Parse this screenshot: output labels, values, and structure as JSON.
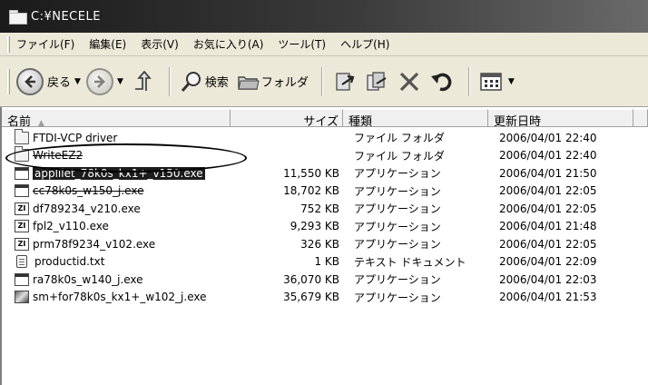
{
  "window": {
    "title": "C:¥NECELE"
  },
  "menu": [
    "ファイル(F)",
    "編集(E)",
    "表示(V)",
    "お気に入り(A)",
    "ツール(T)",
    "ヘルプ(H)"
  ],
  "toolbar": {
    "back_label": "戻る",
    "search_label": "検索",
    "folders_label": "フォルダ"
  },
  "columns": {
    "name": "名前",
    "size": "サイズ",
    "type": "種類",
    "modified": "更新日時"
  },
  "files": [
    {
      "icon": "folder-icon",
      "name": "FTDI-VCP driver",
      "size": "",
      "type": "ファイル フォルダ",
      "modified": "2006/04/01 22:40"
    },
    {
      "icon": "folder-icon",
      "name": "WriteEZ2",
      "size": "",
      "type": "ファイル フォルダ",
      "modified": "2006/04/01 22:40"
    },
    {
      "icon": "application-icon",
      "name": "applilet_78k0s_kx1+_v150.exe",
      "size": "11,550 KB",
      "type": "アプリケーション",
      "modified": "2006/04/01 21:50"
    },
    {
      "icon": "application-icon",
      "name": "cc78k0s_w150_j.exe",
      "size": "18,702 KB",
      "type": "アプリケーション",
      "modified": "2006/04/01 22:05"
    },
    {
      "icon": "archive-icon",
      "name": "df789234_v210.exe",
      "size": "752 KB",
      "type": "アプリケーション",
      "modified": "2006/04/01 22:05"
    },
    {
      "icon": "archive-icon",
      "name": "fpl2_v110.exe",
      "size": "9,293 KB",
      "type": "アプリケーション",
      "modified": "2006/04/01 21:48"
    },
    {
      "icon": "archive-icon",
      "name": "prm78f9234_v102.exe",
      "size": "326 KB",
      "type": "アプリケーション",
      "modified": "2006/04/01 22:05"
    },
    {
      "icon": "text-document-icon",
      "name": "productid.txt",
      "size": "1 KB",
      "type": "テキスト ドキュメント",
      "modified": "2006/04/01 22:09"
    },
    {
      "icon": "application-icon",
      "name": "ra78k0s_w140_j.exe",
      "size": "36,070 KB",
      "type": "アプリケーション",
      "modified": "2006/04/01 22:03"
    },
    {
      "icon": "installer-icon",
      "name": "sm+for78k0s_kx1+_w102_j.exe",
      "size": "35,679 KB",
      "type": "アプリケーション",
      "modified": "2006/04/01 21:53"
    }
  ],
  "selected_index": 2
}
